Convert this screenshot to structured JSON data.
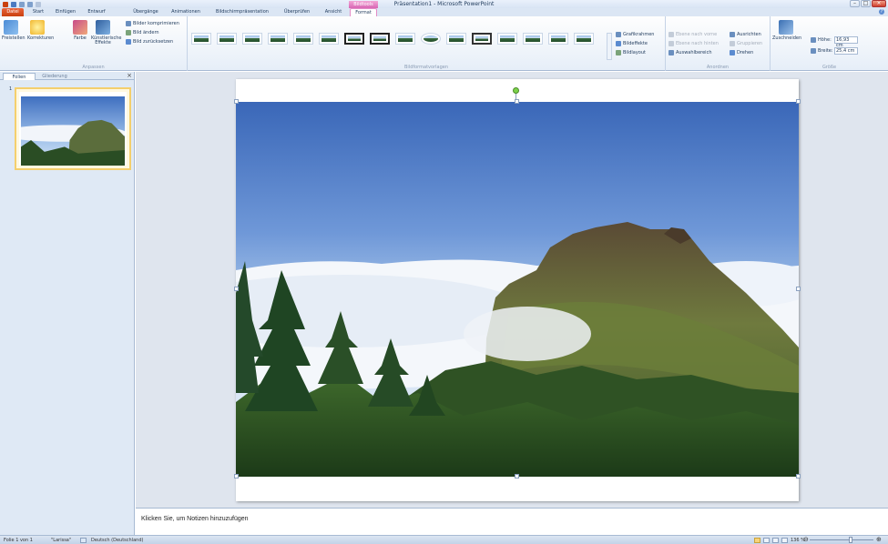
{
  "titlebar": {
    "window_title": "Präsentation1 - Microsoft PowerPoint",
    "context_tab_title": "Bildtools"
  },
  "tabs": [
    "Datei",
    "Start",
    "Einfügen",
    "Entwurf",
    "Übergänge",
    "Animationen",
    "Bildschirmpräsentation",
    "Überprüfen",
    "Ansicht",
    "Format"
  ],
  "active_tab": "Format",
  "ribbon": {
    "anpassen": {
      "label": "Anpassen",
      "freistellen": "Freistellen",
      "korrekturen": "Korrekturen",
      "farbe": "Farbe",
      "kuenstlerische": "Künstlerische Effekte",
      "komprimieren": "Bilder komprimieren",
      "aendern": "Bild ändern",
      "zuruecksetzen": "Bild zurücksetzen"
    },
    "formatvorlagen": {
      "label": "Bildformatvorlagen",
      "grafikrahmen": "Grafikrahmen",
      "bildeffekte": "Bildeffekte",
      "bildlayout": "Bildlayout"
    },
    "anordnen": {
      "label": "Anordnen",
      "ebene_vorne": "Ebene nach vorne",
      "ebene_hinten": "Ebene nach hinten",
      "auswahlbereich": "Auswahlbereich",
      "ausrichten": "Ausrichten",
      "gruppieren": "Gruppieren",
      "drehen": "Drehen"
    },
    "groesse": {
      "label": "Größe",
      "zuschneiden": "Zuschneiden",
      "hoehe_label": "Höhe:",
      "hoehe_value": "16,93 cm",
      "breite_label": "Breite:",
      "breite_value": "25,4 cm"
    }
  },
  "leftpane": {
    "tab_slides": "Folien",
    "tab_outline": "Gliederung",
    "close": "×",
    "slide_number": "1"
  },
  "notes": {
    "placeholder": "Klicken Sie, um Notizen hinzuzufügen"
  },
  "statusbar": {
    "slide_info": "Folie 1 von 1",
    "theme": "\"Larissa\"",
    "language": "Deutsch (Deutschland)",
    "zoom": "136 %"
  },
  "colors": {
    "file_tab": "#c9400f",
    "context_tab": "#d866b4",
    "ribbon_bg": "#e6eef8",
    "edit_bg": "#dfe5ee"
  }
}
